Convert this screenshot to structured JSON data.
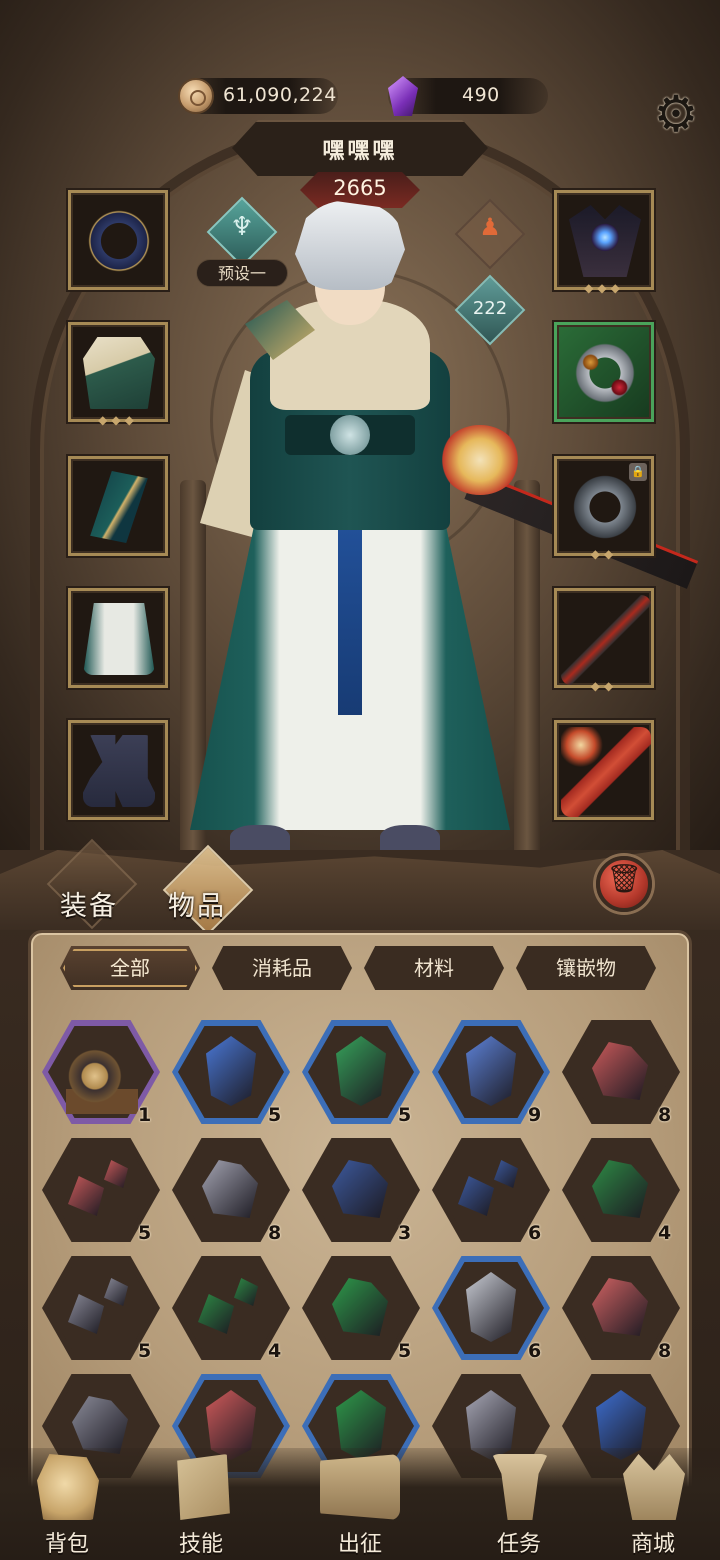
{
  "header": {
    "gold": "61,090,224",
    "gems": "490",
    "settings_icon": "gear-icon"
  },
  "character": {
    "name": "嘿嘿嘿",
    "power": "2665",
    "preset_label": "预设一",
    "attribute_points": "222"
  },
  "equipment": {
    "left": [
      "ring",
      "vest",
      "bracer",
      "skirt",
      "boots"
    ],
    "right": [
      "crown",
      "bracelet",
      "beads",
      "sword",
      "staff"
    ],
    "locked_slot": "beads",
    "highlighted_slot": "bracelet"
  },
  "inventory": {
    "tabs": [
      "装备",
      "物品"
    ],
    "active_tab": "物品",
    "filters": [
      "全部",
      "消耗品",
      "材料",
      "镶嵌物"
    ],
    "active_filter": "全部",
    "items": [
      {
        "kind": "machine",
        "qty": "1",
        "frame": "#7e5aa6"
      },
      {
        "kind": "gem",
        "color": "#4a78d6",
        "qty": "5",
        "frame": "#3c6eb8"
      },
      {
        "kind": "gem",
        "color": "#36a25a",
        "qty": "5",
        "frame": "#3c6eb8"
      },
      {
        "kind": "gem",
        "color": "#5d82d8",
        "qty": "9",
        "frame": "#3c6eb8"
      },
      {
        "kind": "chunk",
        "color": "#c95a5a",
        "qty": "8",
        "frame": "#3a2c22"
      },
      {
        "kind": "pair",
        "color": "#c95a5a",
        "qty": "5",
        "frame": "#3a2c22"
      },
      {
        "kind": "chunk",
        "color": "#a4a4b2",
        "qty": "8",
        "frame": "#3a2c22"
      },
      {
        "kind": "chunk",
        "color": "#3d5a9e",
        "qty": "3",
        "frame": "#3a2c22"
      },
      {
        "kind": "pair",
        "color": "#3d5a9e",
        "qty": "6",
        "frame": "#3a2c22"
      },
      {
        "kind": "chunk",
        "color": "#2e8a45",
        "qty": "4",
        "frame": "#3a2c22"
      },
      {
        "kind": "pair",
        "color": "#8a8a98",
        "qty": "5",
        "frame": "#3a2c22"
      },
      {
        "kind": "pair",
        "color": "#2e8a45",
        "qty": "4",
        "frame": "#3a2c22"
      },
      {
        "kind": "chunk",
        "color": "#2e9a4a",
        "qty": "5",
        "frame": "#3a2c22"
      },
      {
        "kind": "gem",
        "color": "#c9ccd4",
        "qty": "6",
        "frame": "#3c6eb8"
      },
      {
        "kind": "chunk",
        "color": "#d06262",
        "qty": "8",
        "frame": "#3a2c22"
      },
      {
        "kind": "chunk",
        "color": "#8a8a98",
        "qty": "",
        "frame": "#3a2c22"
      },
      {
        "kind": "gem",
        "color": "#d05a5a",
        "qty": "",
        "frame": "#3c6eb8"
      },
      {
        "kind": "gem",
        "color": "#2e9a4a",
        "qty": "",
        "frame": "#3c6eb8"
      },
      {
        "kind": "gem",
        "color": "#a8a8b6",
        "qty": "",
        "frame": "#3a2c22"
      },
      {
        "kind": "gem",
        "color": "#3d6ed0",
        "qty": "",
        "frame": "#3a2c22"
      }
    ]
  },
  "nav": [
    {
      "label": "背包",
      "icon": "bag-icon"
    },
    {
      "label": "技能",
      "icon": "skill-book-icon"
    },
    {
      "label": "出征",
      "icon": "march-flag-icon"
    },
    {
      "label": "任务",
      "icon": "task-scroll-icon"
    },
    {
      "label": "商城",
      "icon": "shop-crown-icon"
    }
  ]
}
